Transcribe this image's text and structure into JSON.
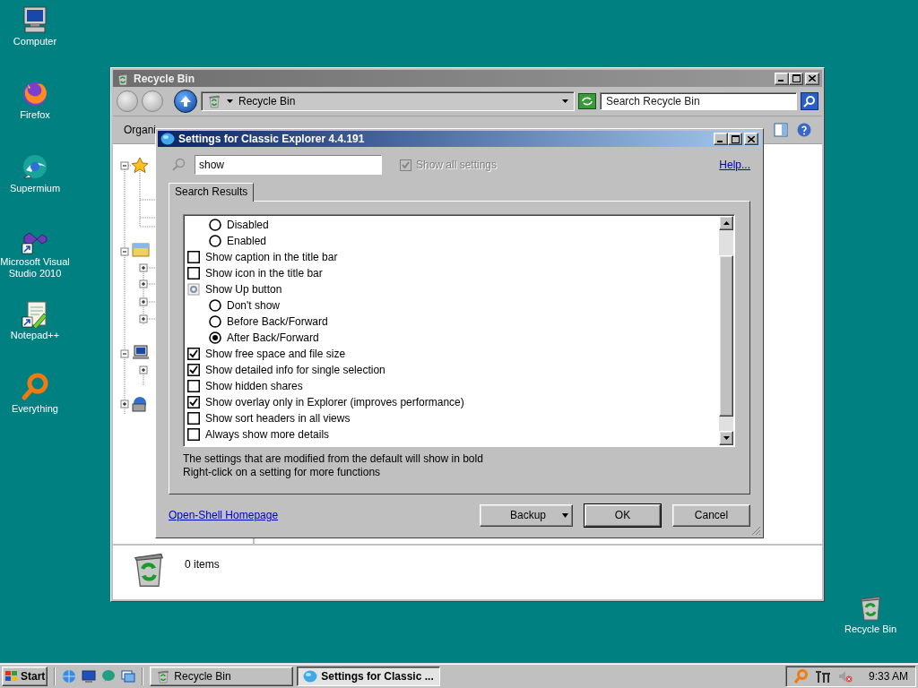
{
  "desktop_icons": [
    {
      "label": "Computer"
    },
    {
      "label": "Firefox"
    },
    {
      "label": "Supermium"
    },
    {
      "label": "Microsoft Visual Studio 2010"
    },
    {
      "label": "Notepad++"
    },
    {
      "label": "Everything"
    },
    {
      "label": "Recycle Bin"
    }
  ],
  "explorer": {
    "title": "Recycle Bin",
    "address": "Recycle Bin",
    "search": {
      "placeholder": "Search Recycle Bin"
    },
    "toolbar_text": "Organi",
    "status": "0 items"
  },
  "dialog": {
    "title": "Settings for Classic Explorer 4.4.191",
    "search": {
      "value": "show"
    },
    "show_all": {
      "label": "Show all settings",
      "checked": true,
      "disabled": true
    },
    "help_link": "Help...",
    "tabs": [
      {
        "label": "Search Results",
        "selected": true
      }
    ],
    "settings": [
      {
        "kind": "radio",
        "label": "Disabled",
        "selected": false
      },
      {
        "kind": "radio",
        "label": "Enabled",
        "selected": false
      },
      {
        "kind": "checkbox",
        "label": "Show caption in the title bar",
        "checked": false
      },
      {
        "kind": "checkbox",
        "label": "Show icon in the title bar",
        "checked": false
      },
      {
        "kind": "group",
        "label": "Show Up button"
      },
      {
        "kind": "radio",
        "label": "Don't show",
        "selected": false
      },
      {
        "kind": "radio",
        "label": "Before Back/Forward",
        "selected": false
      },
      {
        "kind": "radio",
        "label": "After Back/Forward",
        "selected": true
      },
      {
        "kind": "checkbox",
        "label": "Show free space and file size",
        "checked": true
      },
      {
        "kind": "checkbox",
        "label": "Show detailed info for single selection",
        "checked": true
      },
      {
        "kind": "checkbox",
        "label": "Show hidden shares",
        "checked": false
      },
      {
        "kind": "checkbox",
        "label": "Show overlay only in Explorer (improves performance)",
        "checked": true
      },
      {
        "kind": "checkbox",
        "label": "Show sort headers in all views",
        "checked": false
      },
      {
        "kind": "checkbox",
        "label": "Always show more details",
        "checked": false
      }
    ],
    "notes": [
      "The settings that are modified from the default will show in bold",
      "Right-click on a setting for more functions"
    ],
    "homepage_link": "Open-Shell Homepage",
    "buttons": [
      {
        "label": "Backup",
        "kind": "dropdown"
      },
      {
        "label": "OK",
        "kind": "default"
      },
      {
        "label": "Cancel",
        "kind": "normal"
      }
    ]
  },
  "taskbar": {
    "start": "Start",
    "tasks": [
      {
        "label": "Recycle Bin",
        "selected": false
      },
      {
        "label": "Settings for Classic ...",
        "selected": true
      }
    ],
    "clock": "9:33 AM"
  }
}
